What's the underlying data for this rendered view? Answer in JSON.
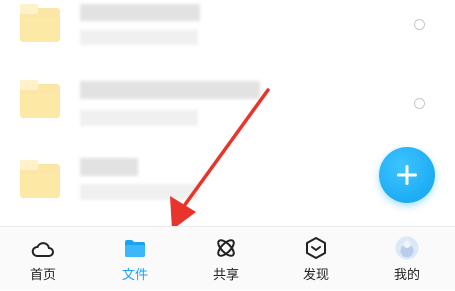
{
  "colors": {
    "accent": "#1aa3f4",
    "fab": "#19aef5",
    "arrow": "#e8342b",
    "folder": "#fbe39a"
  },
  "file_list": {
    "rows": [
      {
        "icon": "folder-icon"
      },
      {
        "icon": "folder-icon"
      },
      {
        "icon": "folder-icon"
      }
    ]
  },
  "fab": {
    "icon": "plus-icon"
  },
  "tabbar": {
    "items": [
      {
        "label": "首页",
        "icon": "home-icon",
        "active": false
      },
      {
        "label": "文件",
        "icon": "folder-icon",
        "active": true
      },
      {
        "label": "共享",
        "icon": "share-atom-icon",
        "active": false
      },
      {
        "label": "发现",
        "icon": "discover-icon",
        "active": false
      },
      {
        "label": "我的",
        "icon": "avatar-icon",
        "active": false
      }
    ]
  }
}
